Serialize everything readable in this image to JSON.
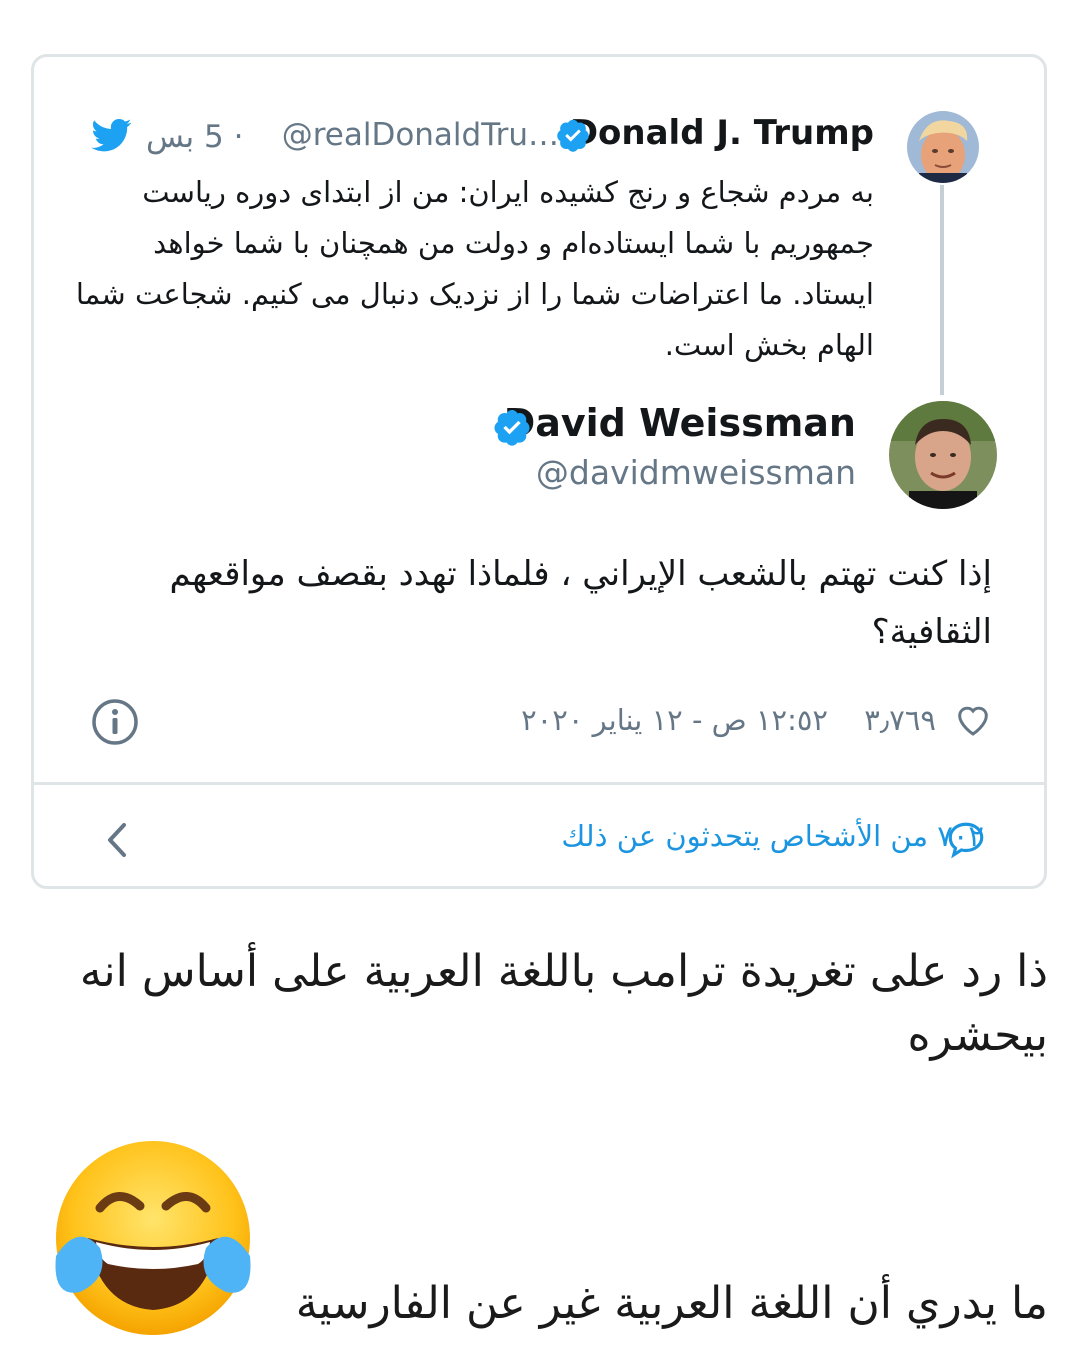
{
  "embed": {
    "quoted": {
      "name": "Donald J. Trump",
      "handle": "@realDonaldTru…",
      "time": "· 5 بس",
      "text": "به مردم شجاع و رنج کشیده ایران: من از ابتدای دوره ریاست جمهوریم با شما ایستاده‌ام و دولت من همچنان با شما خواهد ایستاد. ما اعتراضات شما را از نزدیک دنبال می کنیم. شجاعت شما الهام بخش است.",
      "icon": "twitter-bird-icon"
    },
    "reply": {
      "name": "David Weissman",
      "handle": "@davidmweissman",
      "text": "إذا كنت تهتم بالشعب الإيراني ، فلماذا تهدد بقصف مواقعهم الثقافية؟",
      "likes": "٣٫٧٦٩",
      "timestamp": "١٢:٥٢ ص - ١٢ يناير ٢٠٢٠",
      "talking": "٧٠٢ من الأشخاص يتحدثون عن ذلك"
    },
    "colors": {
      "accent": "#1da1f2",
      "link": "#1b95e0",
      "muted": "#657786",
      "border": "#dfe4e7"
    }
  },
  "captions": {
    "line1": "ذا رد على تغريدة ترامب باللغة العربية على أساس انه بيحشره",
    "line2": "ما يدري أن اللغة العربية غير عن الفارسية",
    "emoji": "face-with-tears-of-joy"
  }
}
